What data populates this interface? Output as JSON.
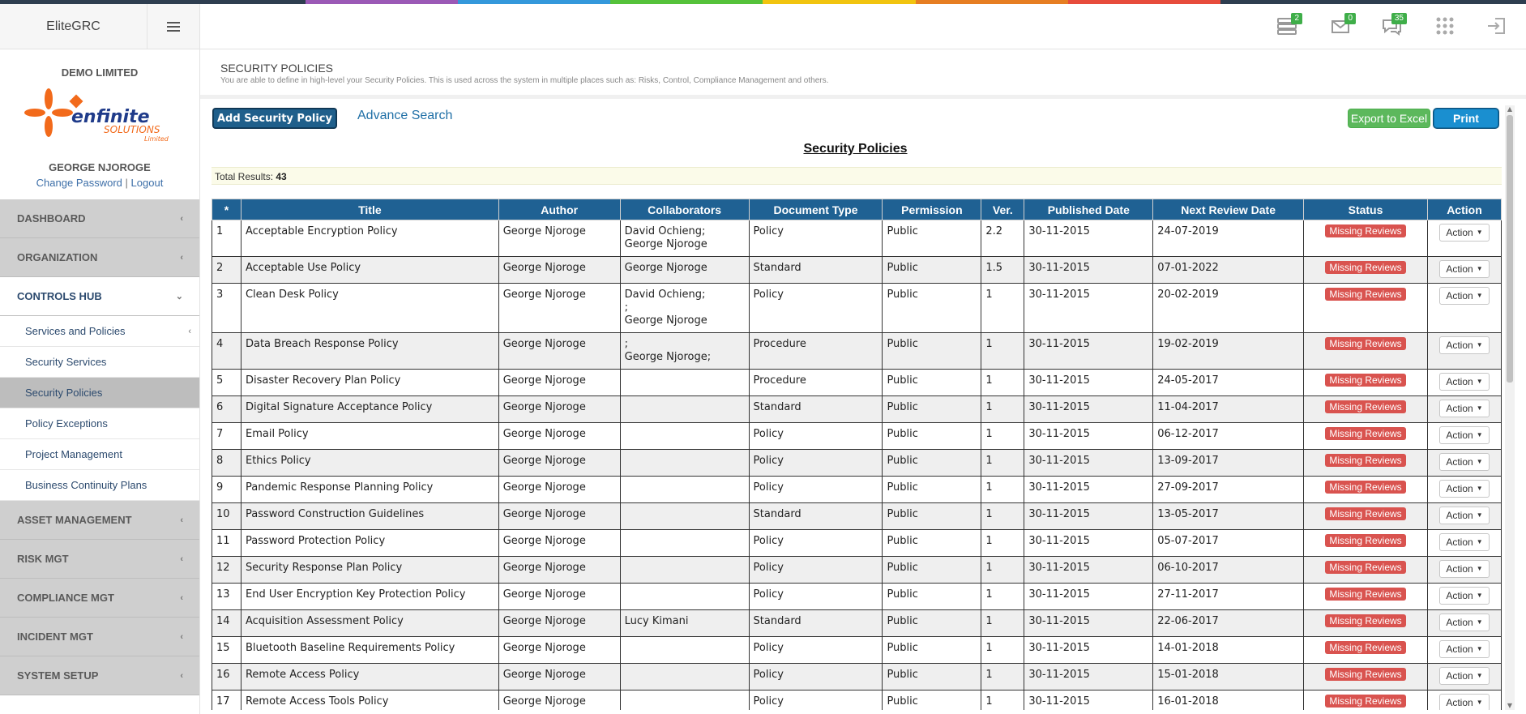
{
  "theme": {
    "strip_colors": [
      "#2e3e50",
      "#2e3e50",
      "#9b59b6",
      "#3498db",
      "#55c23a",
      "#f1c40f",
      "#e67e22",
      "#e74c3c",
      "#2e3e50",
      "#2e3e50"
    ],
    "header_blue": "#1f6193",
    "missing_red": "#d9534f",
    "badge_green": "#3fae49"
  },
  "app": {
    "name": "EliteGRC"
  },
  "profile": {
    "company": "DEMO LIMITED",
    "logo_main": "enfinite",
    "logo_sub": "SOLUTIONS",
    "logo_small": "Limited",
    "user": "GEORGE NJOROGE",
    "change_password": "Change Password",
    "separator": "|",
    "logout": "Logout"
  },
  "header": {
    "icons": [
      {
        "name": "server-icon",
        "badge": "2"
      },
      {
        "name": "mail-icon",
        "badge": "0"
      },
      {
        "name": "chat-icon",
        "badge": "35"
      },
      {
        "name": "grid-icon",
        "badge": ""
      },
      {
        "name": "logout-icon",
        "badge": ""
      }
    ]
  },
  "sidebar": {
    "sections": [
      {
        "label": "DASHBOARD",
        "chevron": "‹"
      },
      {
        "label": "ORGANIZATION",
        "chevron": "‹"
      },
      {
        "label": "CONTROLS HUB",
        "chevron": "⌄"
      },
      {
        "label": "ASSET MANAGEMENT",
        "chevron": "‹"
      },
      {
        "label": "RISK MGT",
        "chevron": "‹"
      },
      {
        "label": "COMPLIANCE MGT",
        "chevron": "‹"
      },
      {
        "label": "INCIDENT MGT",
        "chevron": "‹"
      },
      {
        "label": "SYSTEM SETUP",
        "chevron": "‹"
      }
    ],
    "sub_items": [
      {
        "label": "Services and Policies",
        "chevron": "‹"
      },
      {
        "label": "Security Services"
      },
      {
        "label": "Security Policies"
      },
      {
        "label": "Policy Exceptions"
      },
      {
        "label": "Project Management"
      },
      {
        "label": "Business Continuity Plans"
      }
    ]
  },
  "page": {
    "title": "SECURITY POLICIES",
    "description": "You are able to define in high-level your Security Policies. This is used across the system in multiple places such as: Risks, Control, Compliance Management and others."
  },
  "toolbar": {
    "add_label": "Add Security Policy",
    "advance_search": "Advance Search",
    "export_label": "Export to Excel",
    "print_label": "Print"
  },
  "table": {
    "title": "Security Policies",
    "total_label": "Total Results:",
    "total_value": "43",
    "columns": [
      "*",
      "Title",
      "Author",
      "Collaborators",
      "Document Type",
      "Permission",
      "Ver.",
      "Published Date",
      "Next Review Date",
      "Status",
      "Action"
    ],
    "status_label": "Missing Reviews",
    "action_label": "Action",
    "rows": [
      {
        "n": "1",
        "title": "Acceptable Encryption Policy",
        "author": "George Njoroge",
        "collab": [
          "David Ochieng;",
          "George Njoroge"
        ],
        "type": "Policy",
        "perm": "Public",
        "ver": "2.2",
        "pub": "30-11-2015",
        "next": "24-07-2019"
      },
      {
        "n": "2",
        "title": "Acceptable Use Policy",
        "author": "George Njoroge",
        "collab": [
          "George Njoroge"
        ],
        "type": "Standard",
        "perm": "Public",
        "ver": "1.5",
        "pub": "30-11-2015",
        "next": "07-01-2022"
      },
      {
        "n": "3",
        "title": "Clean Desk Policy",
        "author": "George Njoroge",
        "collab": [
          "David Ochieng;",
          ";",
          "George Njoroge"
        ],
        "type": "Policy",
        "perm": "Public",
        "ver": "1",
        "pub": "30-11-2015",
        "next": "20-02-2019"
      },
      {
        "n": "4",
        "title": "Data Breach Response Policy",
        "author": "George Njoroge",
        "collab": [
          ";",
          "George Njoroge;"
        ],
        "type": "Procedure",
        "perm": "Public",
        "ver": "1",
        "pub": "30-11-2015",
        "next": "19-02-2019"
      },
      {
        "n": "5",
        "title": "Disaster Recovery Plan Policy",
        "author": "George Njoroge",
        "collab": [],
        "type": "Procedure",
        "perm": "Public",
        "ver": "1",
        "pub": "30-11-2015",
        "next": "24-05-2017"
      },
      {
        "n": "6",
        "title": "Digital Signature Acceptance Policy",
        "author": "George Njoroge",
        "collab": [],
        "type": "Standard",
        "perm": "Public",
        "ver": "1",
        "pub": "30-11-2015",
        "next": "11-04-2017"
      },
      {
        "n": "7",
        "title": "Email Policy",
        "author": "George Njoroge",
        "collab": [],
        "type": "Policy",
        "perm": "Public",
        "ver": "1",
        "pub": "30-11-2015",
        "next": "06-12-2017"
      },
      {
        "n": "8",
        "title": "Ethics Policy",
        "author": "George Njoroge",
        "collab": [],
        "type": "Policy",
        "perm": "Public",
        "ver": "1",
        "pub": "30-11-2015",
        "next": "13-09-2017"
      },
      {
        "n": "9",
        "title": "Pandemic Response Planning Policy",
        "author": "George Njoroge",
        "collab": [],
        "type": "Policy",
        "perm": "Public",
        "ver": "1",
        "pub": "30-11-2015",
        "next": "27-09-2017"
      },
      {
        "n": "10",
        "title": "Password Construction Guidelines",
        "author": "George Njoroge",
        "collab": [],
        "type": "Standard",
        "perm": "Public",
        "ver": "1",
        "pub": "30-11-2015",
        "next": "13-05-2017"
      },
      {
        "n": "11",
        "title": "Password Protection Policy",
        "author": "George Njoroge",
        "collab": [],
        "type": "Policy",
        "perm": "Public",
        "ver": "1",
        "pub": "30-11-2015",
        "next": "05-07-2017"
      },
      {
        "n": "12",
        "title": "Security Response Plan Policy",
        "author": "George Njoroge",
        "collab": [],
        "type": "Policy",
        "perm": "Public",
        "ver": "1",
        "pub": "30-11-2015",
        "next": "06-10-2017"
      },
      {
        "n": "13",
        "title": "End User Encryption Key Protection Policy",
        "author": "George Njoroge",
        "collab": [],
        "type": "Policy",
        "perm": "Public",
        "ver": "1",
        "pub": "30-11-2015",
        "next": "27-11-2017"
      },
      {
        "n": "14",
        "title": "Acquisition Assessment Policy",
        "author": "George Njoroge",
        "collab": [
          "Lucy Kimani"
        ],
        "type": "Standard",
        "perm": "Public",
        "ver": "1",
        "pub": "30-11-2015",
        "next": "22-06-2017"
      },
      {
        "n": "15",
        "title": "Bluetooth Baseline Requirements Policy",
        "author": "George Njoroge",
        "collab": [],
        "type": "Policy",
        "perm": "Public",
        "ver": "1",
        "pub": "30-11-2015",
        "next": "14-01-2018"
      },
      {
        "n": "16",
        "title": "Remote Access Policy",
        "author": "George Njoroge",
        "collab": [],
        "type": "Policy",
        "perm": "Public",
        "ver": "1",
        "pub": "30-11-2015",
        "next": "15-01-2018"
      },
      {
        "n": "17",
        "title": "Remote Access Tools Policy",
        "author": "George Njoroge",
        "collab": [],
        "type": "Policy",
        "perm": "Public",
        "ver": "1",
        "pub": "30-11-2015",
        "next": "16-01-2018"
      }
    ]
  }
}
